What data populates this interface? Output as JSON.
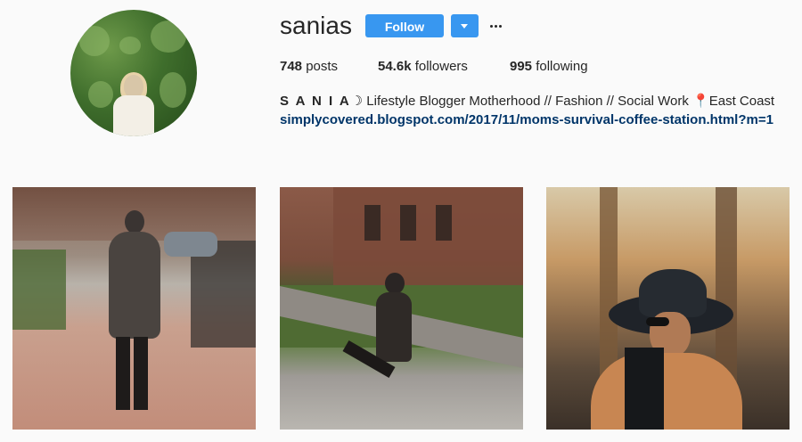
{
  "profile": {
    "username": "sanias",
    "follow_label": "Follow",
    "more_label": "···"
  },
  "stats": {
    "posts_count": "748",
    "posts_label": " posts",
    "followers_count": "54.6k",
    "followers_label": " followers",
    "following_count": "995",
    "following_label": " following"
  },
  "bio": {
    "name": "S A N I A",
    "moon": "☽",
    "description": " Lifestyle Blogger Motherhood // Fashion // Social Work ",
    "pin": "📍",
    "location": "East Coast",
    "link": "simplycovered.blogspot.com/2017/11/moms-survival-coffee-station.html?m=1"
  },
  "colors": {
    "accent": "#3897f0",
    "link": "#003569",
    "text": "#262626",
    "background": "#fafafa"
  },
  "posts": [
    {
      "name": "post-1"
    },
    {
      "name": "post-2"
    },
    {
      "name": "post-3"
    }
  ]
}
